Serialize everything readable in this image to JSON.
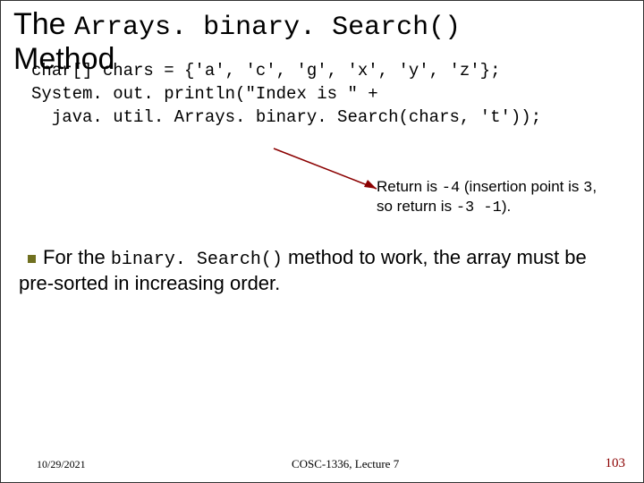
{
  "title": {
    "pre": "The ",
    "mono": "Arrays. binary. Search()",
    "post": " Method"
  },
  "code": {
    "line1": "char[] chars = {'a', 'c', 'g', 'x', 'y', 'z'};",
    "line2": "System. out. println(\"Index is \" +",
    "line3": "  java. util. Arrays. binary. Search(chars, 't'));"
  },
  "annotation": {
    "t1": "Return is ",
    "v1": "-4",
    "t2": " (insertion point is ",
    "v2": "3",
    "t3": ", so return is ",
    "v3": "-3 -1",
    "t4": ")."
  },
  "body": {
    "t1": "For the ",
    "mono": "binary. Search()",
    "t2": " method to work, the array must be pre-sorted in increasing order."
  },
  "footer": {
    "date": "10/29/2021",
    "center": "COSC-1336, Lecture 7",
    "page": "103"
  }
}
